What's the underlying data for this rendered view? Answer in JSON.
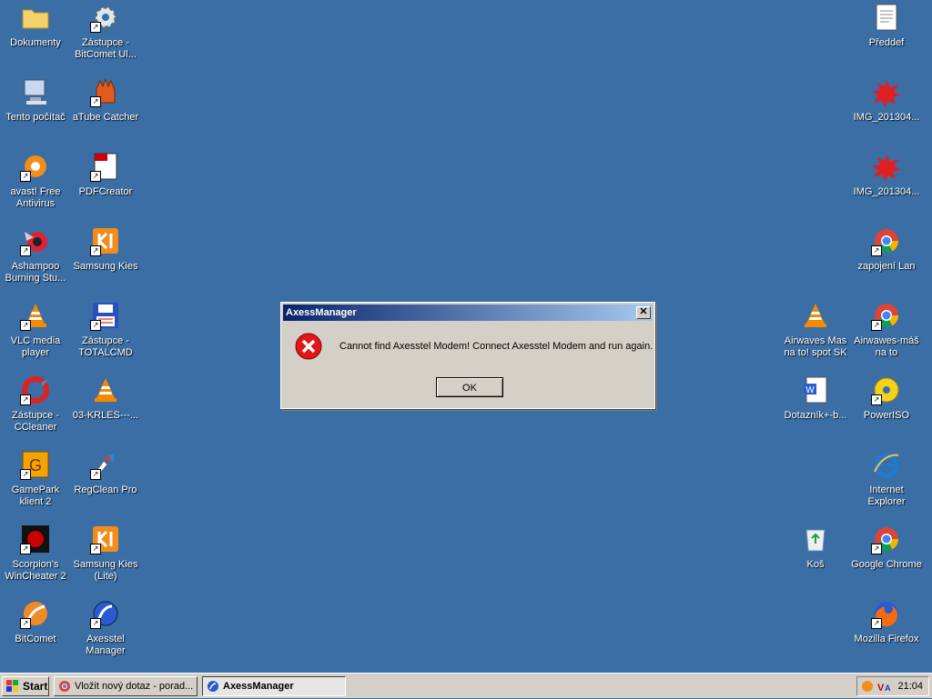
{
  "desktop": {
    "icons": [
      {
        "label": "Dokumenty"
      },
      {
        "label": "Zástupce - BitComet Ul..."
      },
      {
        "label": "Tento počítač"
      },
      {
        "label": "aTube Catcher"
      },
      {
        "label": "avast! Free Antivirus"
      },
      {
        "label": "PDFCreator"
      },
      {
        "label": "Ashampoo Burning Stu..."
      },
      {
        "label": "Samsung Kies"
      },
      {
        "label": "VLC media player"
      },
      {
        "label": "Zástupce - TOTALCMD"
      },
      {
        "label": "Zástupce - CCleaner"
      },
      {
        "label": "03-KRLES---..."
      },
      {
        "label": "GamePark klient 2"
      },
      {
        "label": "RegClean Pro"
      },
      {
        "label": "Scorpion's WinCheater 2"
      },
      {
        "label": "Samsung Kies (Lite)"
      },
      {
        "label": "BitComet"
      },
      {
        "label": "Axesstel Manager"
      },
      {
        "label": "Předdef"
      },
      {
        "label": "IMG_201304..."
      },
      {
        "label": "IMG_201304..."
      },
      {
        "label": "zapojení Lan"
      },
      {
        "label": "Airwaves   Mas na to!   spot SK"
      },
      {
        "label": "Airwawes-máš na to"
      },
      {
        "label": "Dotazník+-b..."
      },
      {
        "label": "PowerISO"
      },
      {
        "label": "Internet Explorer"
      },
      {
        "label": "Koš"
      },
      {
        "label": "Google Chrome"
      },
      {
        "label": "Mozilla Firefox"
      }
    ]
  },
  "dialog": {
    "title": "AxessManager",
    "close": "✕",
    "message": "Cannot find Axesstel Modem! Connect Axesstel Modem and run again.",
    "ok": "OK"
  },
  "taskbar": {
    "start": "Start",
    "tasks": [
      {
        "label": "Vložit nový dotaz - porad..."
      },
      {
        "label": "AxessManager"
      }
    ],
    "clock": "21:04"
  }
}
